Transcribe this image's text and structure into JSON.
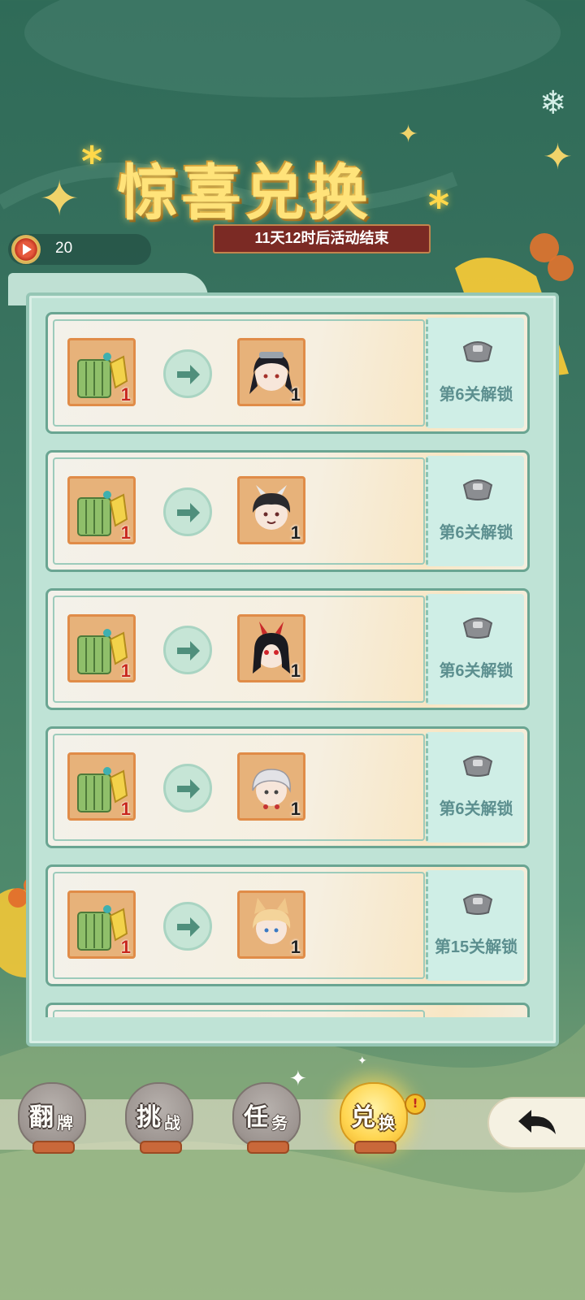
{
  "header": {
    "title": "惊喜兑换",
    "countdown": "11天12时后活动结束"
  },
  "currency": {
    "icon": "ticket-coin-icon",
    "value": "20"
  },
  "exchange_rows": [
    {
      "cost_item": "bamboo-scroll-icon",
      "cost_count": "1",
      "reward_item": "hero-avatar-black-hair",
      "reward_count": "1",
      "lock_icon": "lock-icon",
      "unlock_label": "第6关解锁"
    },
    {
      "cost_item": "bamboo-scroll-icon",
      "cost_count": "1",
      "reward_item": "hero-avatar-horned-dark",
      "reward_count": "1",
      "lock_icon": "lock-icon",
      "unlock_label": "第6关解锁"
    },
    {
      "cost_item": "bamboo-scroll-icon",
      "cost_count": "1",
      "reward_item": "hero-avatar-red-horns",
      "reward_count": "1",
      "lock_icon": "lock-icon",
      "unlock_label": "第6关解锁"
    },
    {
      "cost_item": "bamboo-scroll-icon",
      "cost_count": "1",
      "reward_item": "hero-avatar-silver-hair",
      "reward_count": "1",
      "lock_icon": "lock-icon",
      "unlock_label": "第6关解锁"
    },
    {
      "cost_item": "bamboo-scroll-icon",
      "cost_count": "1",
      "reward_item": "hero-avatar-fox-ears",
      "reward_count": "1",
      "lock_icon": "lock-icon",
      "unlock_label": "第15关解锁"
    }
  ],
  "nav": {
    "tabs": [
      {
        "main": "翻",
        "sub": "牌"
      },
      {
        "main": "挑",
        "sub": "战"
      },
      {
        "main": "任",
        "sub": "务"
      },
      {
        "main": "兑",
        "sub": "换"
      }
    ],
    "active_tab": "兑换",
    "notification_badge": "!",
    "back_icon": "back-arrow-icon"
  },
  "colors": {
    "accent_gold": "#ffe37a",
    "banner_red": "#7b2a24",
    "panel_teal": "#bfe3d6",
    "item_slot_orange": "#e7b27a",
    "count_red": "#c8281e"
  }
}
